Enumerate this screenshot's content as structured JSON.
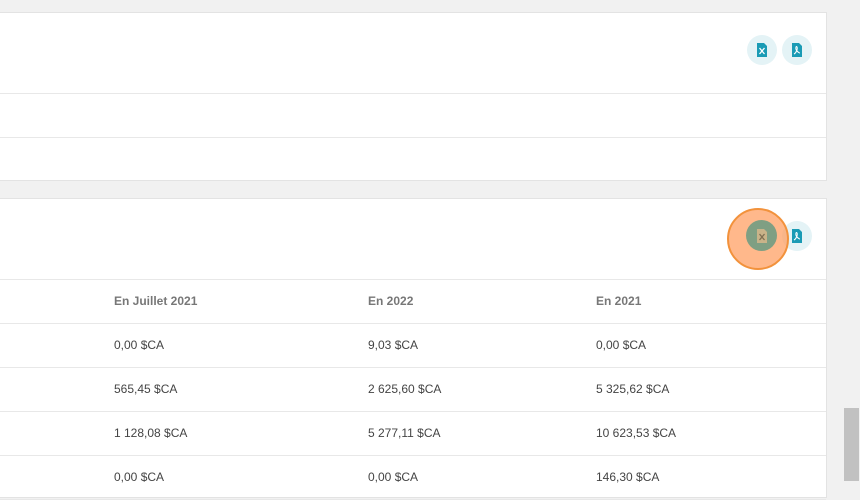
{
  "colors": {
    "accent": "#1a9bb5",
    "icon_bg": "#e4f3f6",
    "click_highlight": "#f2923c"
  },
  "top_card": {
    "actions": [
      {
        "icon": "excel-file-icon",
        "label": ""
      },
      {
        "icon": "pdf-file-icon",
        "label": ""
      }
    ]
  },
  "bottom_card": {
    "actions": [
      {
        "icon": "excel-file-icon",
        "label": ""
      },
      {
        "icon": "pdf-file-icon",
        "label": ""
      }
    ],
    "table": {
      "headers": [
        "En Juillet 2021",
        "En 2022",
        "En 2021"
      ],
      "rows": [
        [
          "0,00 $CA",
          "9,03 $CA",
          "0,00 $CA"
        ],
        [
          "565,45 $CA",
          "2 625,60 $CA",
          "5 325,62 $CA"
        ],
        [
          "1 128,08 $CA",
          "5 277,11 $CA",
          "10 623,53 $CA"
        ],
        [
          "0,00 $CA",
          "0,00 $CA",
          "146,30 $CA"
        ]
      ]
    }
  }
}
